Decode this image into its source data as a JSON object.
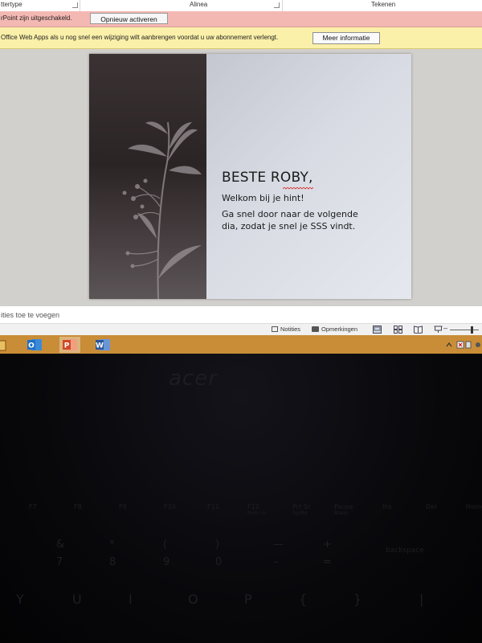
{
  "ribbon": {
    "groups": [
      "ttertype",
      "Alinea",
      "Tekenen"
    ]
  },
  "protected_view": {
    "message": "rPoint zijn uitgeschakeld.",
    "reactivate_label": "Opnieuw activeren"
  },
  "webapps_notice": {
    "message": "Office Web Apps als u nog snel een wijziging wilt aanbrengen voordat u uw abonnement verlengt.",
    "more_info_label": "Meer informatie"
  },
  "slide": {
    "title": "BESTE ROBY,",
    "lines": [
      "Welkom bij je hint!",
      "Ga snel door naar de volgende",
      "dia, zodat je snel je SSS vindt."
    ]
  },
  "notes_hint": "ities toe te voegen",
  "status_bar": {
    "notes_label": "Notities",
    "comments_label": "Opmerkingen"
  },
  "taskbar": {
    "apps": [
      "outlook-icon",
      "powerpoint-icon",
      "word-icon"
    ],
    "active": "powerpoint-icon"
  },
  "laptop": {
    "brand": "acer",
    "fn_keys": [
      "F7",
      "F8",
      "F9",
      "F10",
      "F11",
      "F12",
      "Prt Sc",
      "Pause",
      "Ins",
      "Del",
      "Home"
    ],
    "fn_sub": [
      "",
      "",
      "",
      "",
      "",
      "Num Lk",
      "SysRq",
      "Break",
      "",
      "",
      ""
    ],
    "number_row_top": [
      "&",
      "*",
      "(",
      ")",
      "—",
      "+"
    ],
    "number_row_bottom": [
      "7",
      "8",
      "9",
      "0",
      "–",
      "="
    ],
    "backspace_label": "backspace",
    "letter_row": [
      "Y",
      "U",
      "I",
      "O",
      "P",
      "{",
      "}",
      "|"
    ]
  },
  "colors": {
    "protected_bar": "#f4b8b2",
    "webapps_bar": "#fbf0a9",
    "taskbar": "#c98d37",
    "outlook": "#1f6fc5",
    "powerpoint": "#d24726",
    "word": "#2b579a"
  }
}
